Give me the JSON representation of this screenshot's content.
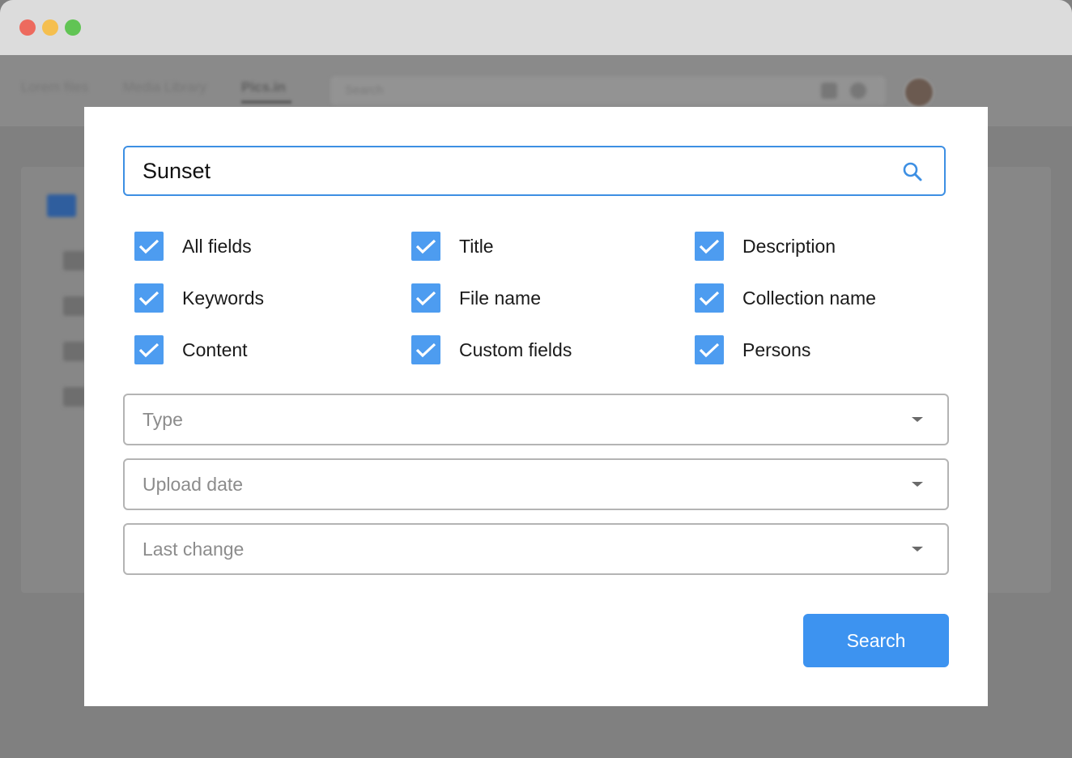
{
  "window": {
    "controls": [
      "close",
      "minimize",
      "maximize"
    ]
  },
  "background": {
    "tabs": [
      {
        "label": "Lorem files"
      },
      {
        "label": "Media Library"
      },
      {
        "label": "Pics.in"
      }
    ],
    "search_placeholder": "Search",
    "icons": [
      "grid-icon",
      "search-icon",
      "avatar"
    ]
  },
  "modal": {
    "search_value": "Sunset",
    "search_icon": "search-icon",
    "checkboxes": [
      {
        "label": "All fields",
        "checked": true
      },
      {
        "label": "Title",
        "checked": true
      },
      {
        "label": "Description",
        "checked": true
      },
      {
        "label": "Keywords",
        "checked": true
      },
      {
        "label": "File name",
        "checked": true
      },
      {
        "label": "Collection name",
        "checked": true
      },
      {
        "label": "Content",
        "checked": true
      },
      {
        "label": "Custom fields",
        "checked": true
      },
      {
        "label": "Persons",
        "checked": true
      }
    ],
    "selects": [
      {
        "placeholder": "Type"
      },
      {
        "placeholder": "Upload date"
      },
      {
        "placeholder": "Last change"
      }
    ],
    "search_button": "Search"
  },
  "colors": {
    "accent": "#3d93f0",
    "checkbox": "#4d9cf0",
    "focus_border": "#3d8fe3",
    "overlay": "#808080"
  }
}
